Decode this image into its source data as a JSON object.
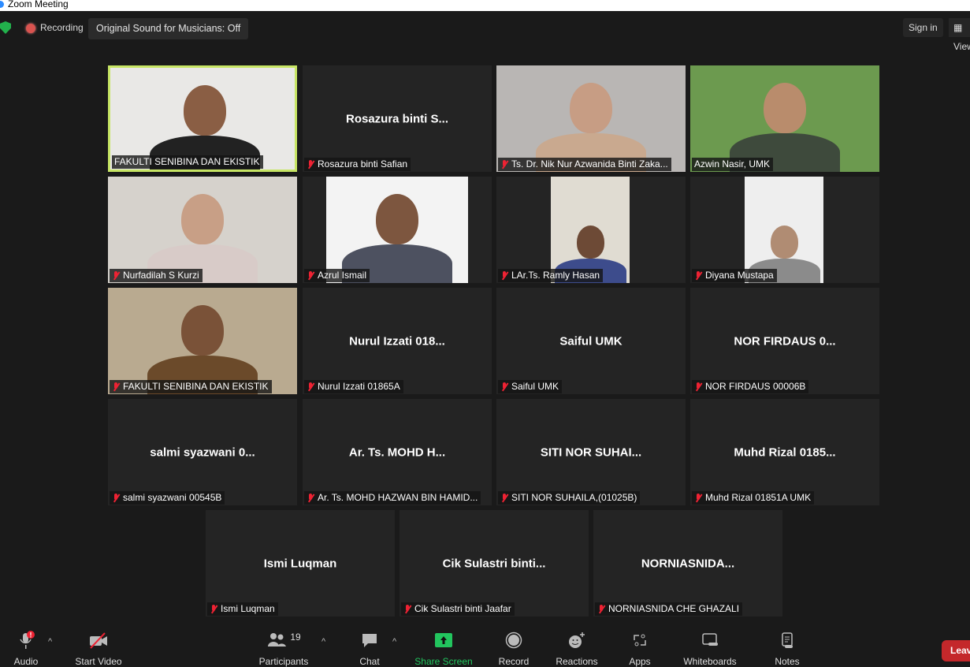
{
  "window": {
    "title": "Zoom Meeting"
  },
  "topbar": {
    "recording": "Recording",
    "original_sound": "Original Sound for Musicians: Off",
    "sign_in": "Sign in",
    "view": "View"
  },
  "tiles": [
    {
      "big": "",
      "name": "FAKULTI SENIBINA DAN EKISTIK",
      "video": true,
      "muted": false,
      "active": true
    },
    {
      "big": "Rosazura binti S...",
      "name": "Rosazura binti Safian",
      "muted": true
    },
    {
      "big": "",
      "name": "Ts. Dr. Nik Nur Azwanida Binti Zaka...",
      "video": true,
      "muted": true
    },
    {
      "big": "",
      "name": "Azwin Nasir, UMK",
      "video": true,
      "muted": false
    },
    {
      "big": "",
      "name": "Nurfadilah S Kurzi",
      "video": true,
      "muted": true
    },
    {
      "big": "",
      "name": "Azrul Ismail",
      "video": true,
      "muted": true
    },
    {
      "big": "",
      "name": "LAr.Ts. Ramly Hasan",
      "video": true,
      "muted": true
    },
    {
      "big": "",
      "name": "Diyana Mustapa",
      "video": true,
      "muted": true
    },
    {
      "big": "",
      "name": "FAKULTI SENIBINA DAN EKISTIK",
      "video": true,
      "muted": true
    },
    {
      "big": "Nurul Izzati 018...",
      "name": "Nurul Izzati 01865A",
      "muted": true
    },
    {
      "big": "Saiful UMK",
      "name": "Saiful UMK",
      "muted": true
    },
    {
      "big": "NOR FIRDAUS 0...",
      "name": "NOR FIRDAUS 00006B",
      "muted": true
    },
    {
      "big": "salmi syazwani 0...",
      "name": "salmi syazwani 00545B",
      "muted": true
    },
    {
      "big": "Ar. Ts. MOHD H...",
      "name": "Ar. Ts. MOHD HAZWAN BIN HAMID...",
      "muted": true
    },
    {
      "big": "SITI NOR SUHAI...",
      "name": "SITI NOR SUHAILA,(01025B)",
      "muted": true
    },
    {
      "big": "Muhd Rizal 0185...",
      "name": "Muhd Rizal 01851A UMK",
      "muted": true
    },
    {
      "big": "Ismi Luqman",
      "name": "Ismi Luqman",
      "muted": true
    },
    {
      "big": "Cik Sulastri binti...",
      "name": "Cik Sulastri binti Jaafar",
      "muted": true
    },
    {
      "big": "NORNIASNIDA...",
      "name": "NORNIASNIDA CHE GHAZALI",
      "muted": true
    }
  ],
  "toolbar": {
    "audio": "Audio",
    "start_video": "Start Video",
    "participants": "Participants",
    "participant_count": "19",
    "chat": "Chat",
    "share_screen": "Share Screen",
    "record": "Record",
    "reactions": "Reactions",
    "apps": "Apps",
    "whiteboards": "Whiteboards",
    "notes": "Notes",
    "leave": "Leave"
  },
  "colors": {
    "active_speaker": "#c7e564",
    "share": "#22c55e",
    "leave": "#c4282b",
    "muted": "#e22233"
  }
}
